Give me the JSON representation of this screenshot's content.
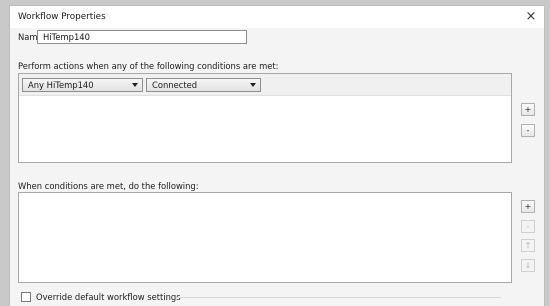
{
  "window": {
    "title": "Workflow Properties",
    "close_glyph": "×"
  },
  "name_field": {
    "label": "Name:",
    "value": "HiTemp140"
  },
  "conditions": {
    "heading": "Perform actions when any of the following conditions are met:",
    "row": {
      "device": "Any HiTemp140",
      "state": "Connected"
    },
    "add_glyph": "+",
    "remove_glyph": "-"
  },
  "actions": {
    "heading": "When conditions are met, do the following:",
    "add_glyph": "+",
    "remove_glyph": "-",
    "up_glyph": "↑",
    "down_glyph": "↓"
  },
  "override": {
    "label": "Override default workflow settings",
    "checked": false
  }
}
